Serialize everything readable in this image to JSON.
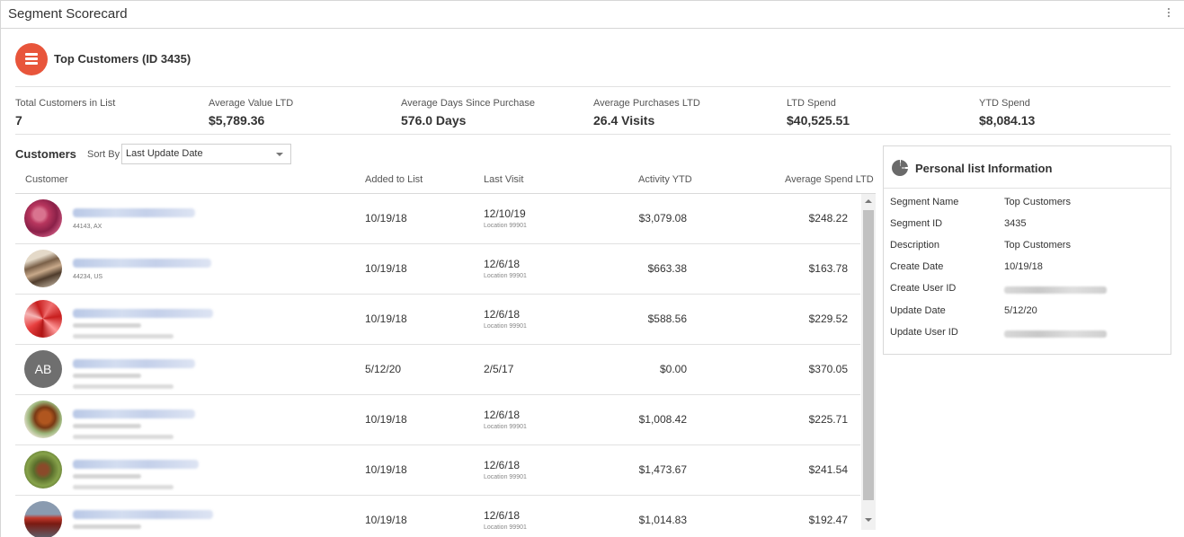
{
  "window": {
    "title": "Segment Scorecard",
    "menu_icon": "more-vertical-icon"
  },
  "segment": {
    "title": "Top Customers (ID 3435)",
    "icon": "list-icon",
    "icon_color": "#e8553b"
  },
  "stats": [
    {
      "label": "Total Customers in List",
      "value": "7"
    },
    {
      "label": "Average Value LTD",
      "value": "$5,789.36"
    },
    {
      "label": "Average Days Since Purchase",
      "value": "576.0 Days"
    },
    {
      "label": "Average Purchases LTD",
      "value": "26.4 Visits"
    },
    {
      "label": "LTD Spend",
      "value": "$40,525.51"
    },
    {
      "label": "YTD Spend",
      "value": "$8,084.13"
    }
  ],
  "customers": {
    "title": "Customers",
    "sort_label": "Sort By",
    "sort_value": "Last Update Date",
    "columns": [
      "Customer",
      "Added to List",
      "Last Visit",
      "Activity YTD",
      "Average Spend LTD"
    ],
    "rows": [
      {
        "location": "44143, AX",
        "added": "10/19/18",
        "last_visit": "12/10/19",
        "visit_location": "Location 99901",
        "activity_ytd": "$3,079.08",
        "avg_spend": "$248.22"
      },
      {
        "location": "44234, US",
        "added": "10/19/18",
        "last_visit": "12/6/18",
        "visit_location": "Location 99901",
        "activity_ytd": "$663.38",
        "avg_spend": "$163.78"
      },
      {
        "added": "10/19/18",
        "last_visit": "12/6/18",
        "visit_location": "Location 99901",
        "activity_ytd": "$588.56",
        "avg_spend": "$229.52"
      },
      {
        "initials": "AB",
        "added": "5/12/20",
        "last_visit": "2/5/17",
        "activity_ytd": "$0.00",
        "avg_spend": "$370.05"
      },
      {
        "added": "10/19/18",
        "last_visit": "12/6/18",
        "visit_location": "Location 99901",
        "activity_ytd": "$1,008.42",
        "avg_spend": "$225.71"
      },
      {
        "added": "10/19/18",
        "last_visit": "12/6/18",
        "visit_location": "Location 99901",
        "activity_ytd": "$1,473.67",
        "avg_spend": "$241.54"
      },
      {
        "added": "10/19/18",
        "last_visit": "12/6/18",
        "visit_location": "Location 99901",
        "activity_ytd": "$1,014.83",
        "avg_spend": "$192.47"
      }
    ]
  },
  "panel": {
    "title": "Personal list Information",
    "icon": "pie-chart-icon",
    "fields": [
      {
        "label": "Segment Name",
        "value": "Top Customers"
      },
      {
        "label": "Segment ID",
        "value": "3435"
      },
      {
        "label": "Description",
        "value": "Top Customers"
      },
      {
        "label": "Create Date",
        "value": "10/19/18"
      },
      {
        "label": "Create User ID",
        "value": ""
      },
      {
        "label": "Update Date",
        "value": "5/12/20"
      },
      {
        "label": "Update User ID",
        "value": ""
      }
    ]
  }
}
